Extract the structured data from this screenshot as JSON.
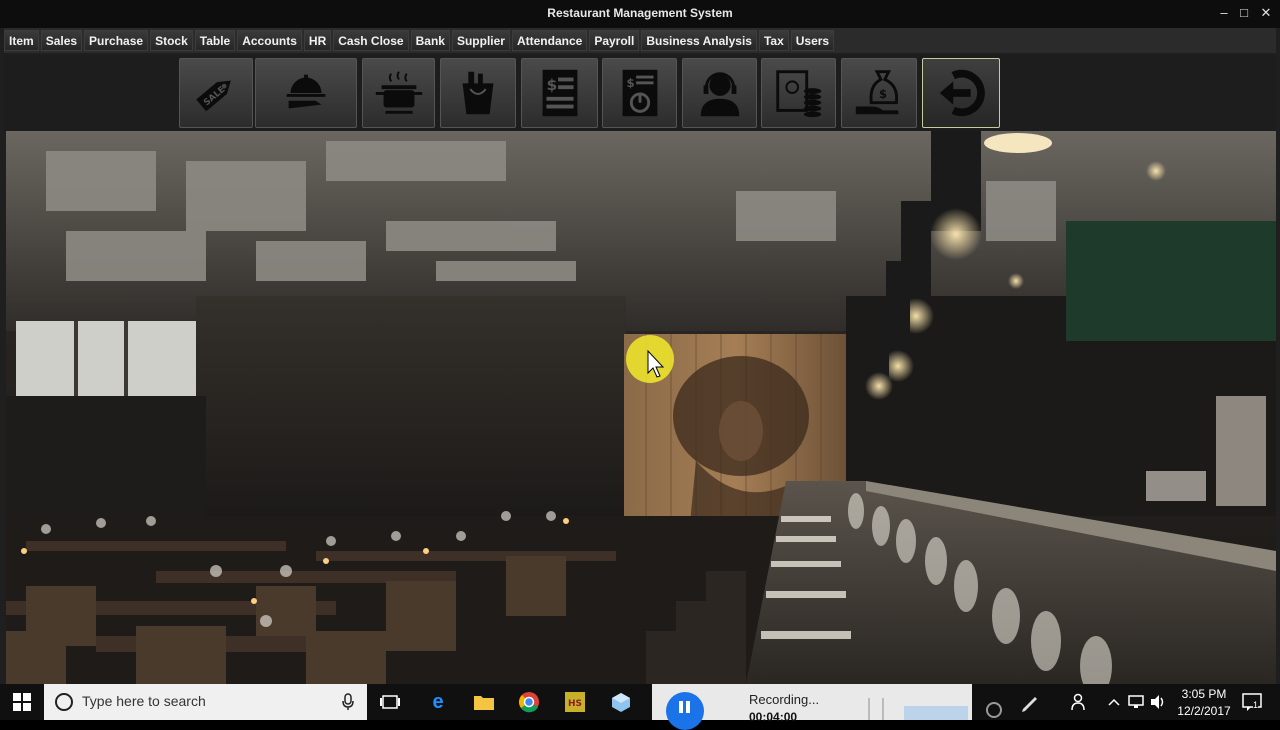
{
  "window": {
    "title": "Restaurant Management System"
  },
  "menu": [
    "Item",
    "Sales",
    "Purchase",
    "Stock",
    "Table",
    "Accounts",
    "HR",
    "Cash Close",
    "Bank",
    "Supplier",
    "Attendance",
    "Payroll",
    "Business Analysis",
    "Tax",
    "Users"
  ],
  "toolbar": {
    "buttons": [
      {
        "icon": "sale-tag-icon"
      },
      {
        "icon": "serving-tray-icon"
      },
      {
        "icon": "cooking-pot-icon"
      },
      {
        "icon": "grocery-bag-icon"
      },
      {
        "icon": "invoice-icon"
      },
      {
        "icon": "report-chart-icon"
      },
      {
        "icon": "support-headset-icon"
      },
      {
        "icon": "cash-coins-icon"
      },
      {
        "icon": "money-bag-hand-icon"
      },
      {
        "icon": "logout-icon"
      }
    ]
  },
  "taskbar": {
    "search_placeholder": "Type here to search",
    "recording_label": "Recording...",
    "recording_time": "00:04:00",
    "time": "3:05 PM",
    "date": "12/2/2017",
    "notification_count": "1"
  }
}
